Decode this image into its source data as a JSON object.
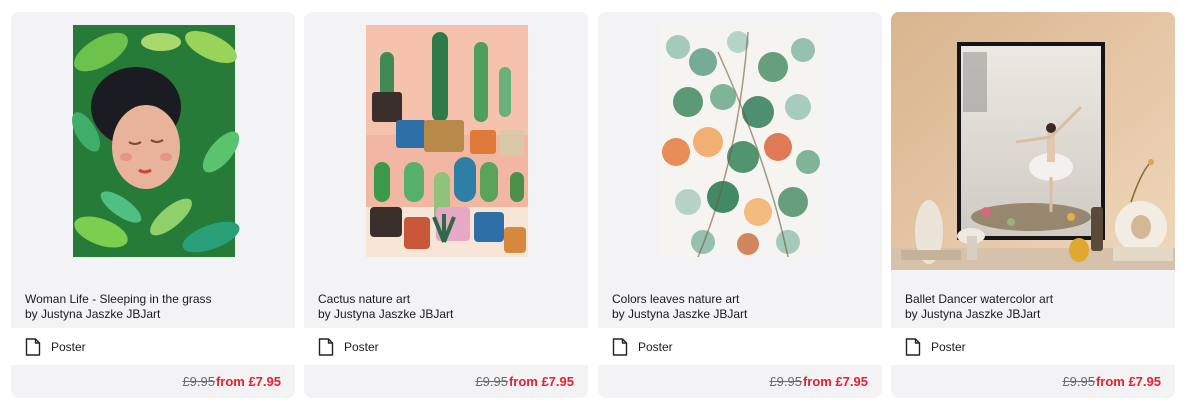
{
  "products": [
    {
      "title": "Woman Life - Sleeping in the grass",
      "artist": "by Justyna Jaszke JBJart",
      "variant": "Poster",
      "variant_icon": "document-icon",
      "old_price": "£9.95",
      "new_price": "from £7.95"
    },
    {
      "title": "Cactus nature art",
      "artist": "by Justyna Jaszke JBJart",
      "variant": "Poster",
      "variant_icon": "document-icon",
      "old_price": "£9.95",
      "new_price": "from £7.95"
    },
    {
      "title": "Colors leaves nature art",
      "artist": "by Justyna Jaszke JBJart",
      "variant": "Poster",
      "variant_icon": "document-icon",
      "old_price": "£9.95",
      "new_price": "from £7.95"
    },
    {
      "title": "Ballet Dancer watercolor art",
      "artist": "by Justyna Jaszke JBJart",
      "variant": "Poster",
      "variant_icon": "document-icon",
      "old_price": "£9.95",
      "new_price": "from £7.95"
    }
  ],
  "colors": {
    "card_bg": "#f3f3f5",
    "sale_price": "#e3232c",
    "old_price": "#6b6b6b"
  }
}
